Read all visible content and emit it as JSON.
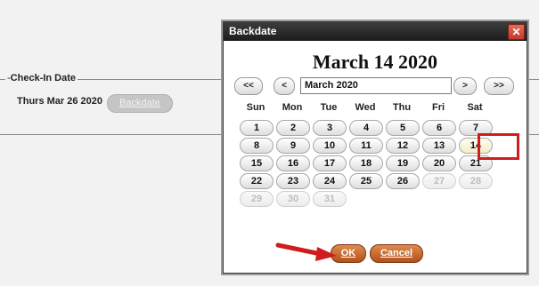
{
  "form": {
    "section_label": "Check-In Date",
    "checkin_date": "Thurs Mar 26 2020",
    "backdate_button": "Backdate"
  },
  "dialog": {
    "title": "Backdate",
    "close_icon": "close-icon",
    "selected_date": "March 14 2020",
    "nav": {
      "prev_year": "<<",
      "prev_month": "<",
      "month_value": "March 2020",
      "next_month": ">",
      "next_year": ">>"
    },
    "weekdays": [
      "Sun",
      "Mon",
      "Tue",
      "Wed",
      "Thu",
      "Fri",
      "Sat"
    ],
    "weeks": [
      [
        "1",
        "2",
        "3",
        "4",
        "5",
        "6",
        "7"
      ],
      [
        "8",
        "9",
        "10",
        "11",
        "12",
        "13",
        "14"
      ],
      [
        "15",
        "16",
        "17",
        "18",
        "19",
        "20",
        "21"
      ],
      [
        "22",
        "23",
        "24",
        "25",
        "26",
        "27",
        "28"
      ],
      [
        "29",
        "30",
        "31"
      ]
    ],
    "disabled_days": [
      "27",
      "28",
      "29",
      "30",
      "31"
    ],
    "selected_day": "14",
    "ok_button": "OK",
    "cancel_button": "Cancel",
    "highlight_color": "#d01c1c"
  }
}
